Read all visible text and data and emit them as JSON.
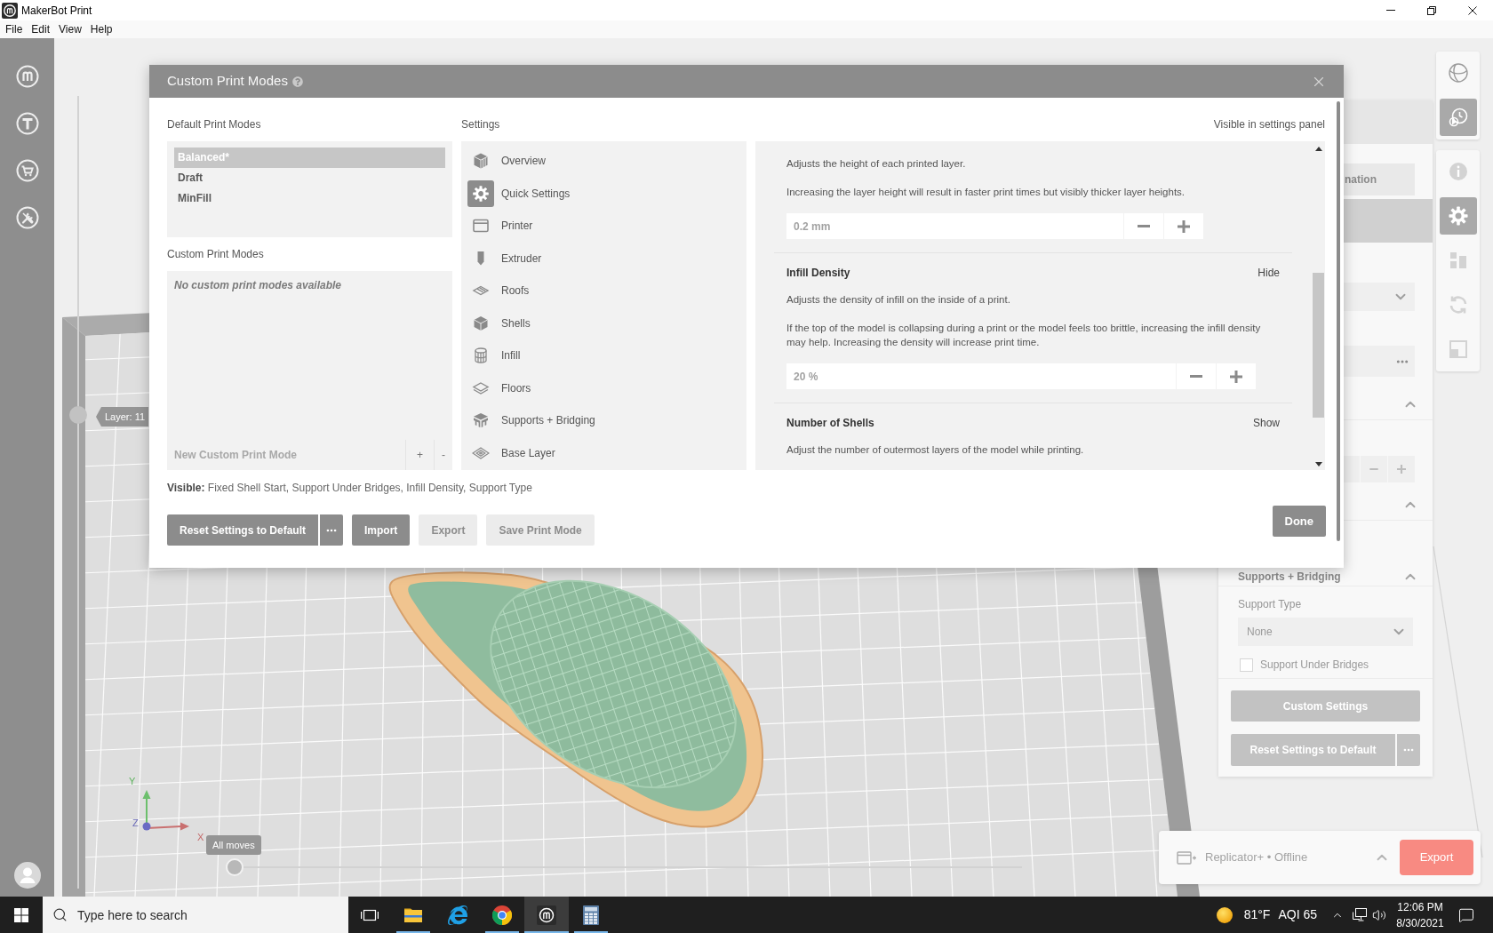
{
  "window": {
    "title": "MakerBot Print"
  },
  "menu": [
    {
      "label": "File"
    },
    {
      "label": "Edit"
    },
    {
      "label": "View"
    },
    {
      "label": "Help"
    }
  ],
  "viewport": {
    "layer_slider": {
      "label": "Layer: 11",
      "level": 0.6
    },
    "moves_slider": {
      "label": "All moves",
      "level": 0
    },
    "axes": {
      "x": "X",
      "y": "Y",
      "z": "Z"
    }
  },
  "dialog": {
    "title": "Custom Print Modes",
    "default_modes": {
      "label": "Default Print Modes",
      "items": [
        {
          "name": "Balanced*",
          "selected": true
        },
        {
          "name": "Draft",
          "selected": false
        },
        {
          "name": "MinFill",
          "selected": false
        }
      ]
    },
    "custom_modes": {
      "label": "Custom Print Modes",
      "empty_text": "No custom print modes available",
      "new_mode": {
        "placeholder": "New Custom Print Mode"
      },
      "add": "+",
      "remove": "-"
    },
    "settings": {
      "label": "Settings",
      "items": [
        {
          "name": "Overview",
          "selected": false
        },
        {
          "name": "Quick Settings",
          "selected": true
        },
        {
          "name": "Printer",
          "selected": false
        },
        {
          "name": "Extruder",
          "selected": false
        },
        {
          "name": "Roofs",
          "selected": false
        },
        {
          "name": "Shells",
          "selected": false
        },
        {
          "name": "Infill",
          "selected": false
        },
        {
          "name": "Floors",
          "selected": false
        },
        {
          "name": "Supports + Bridging",
          "selected": false
        },
        {
          "name": "Base Layer",
          "selected": false
        }
      ]
    },
    "details": {
      "label": "Visible in settings panel",
      "sections": [
        {
          "descriptions": [
            "Adjusts the height of each printed layer.",
            "Increasing the layer height will result in faster print times but visibly thicker layer heights."
          ],
          "value": "0.2 mm"
        },
        {
          "title": "Infill Density",
          "toggle": "Hide",
          "descriptions": [
            "Adjusts the density of infill on the inside of a print.",
            "If the top of the model is collapsing during a print or the model feels too brittle, increasing the infill density may help. Increasing the density will increase print time."
          ],
          "value": "20 %"
        },
        {
          "title": "Number of Shells",
          "toggle": "Show",
          "descriptions": [
            "Adjust the number of outermost layers of the model while printing."
          ]
        }
      ]
    },
    "visible_summary": "**Visible:** Fixed Shell Start, Support Under Bridges, Infill Density, Support Type",
    "buttons": [
      {
        "label": "Reset Settings to Default",
        "kind": "split",
        "disabled": false
      },
      {
        "label": "Import",
        "kind": "plain",
        "disabled": false
      },
      {
        "label": "Export",
        "kind": "plain",
        "disabled": true
      },
      {
        "label": "Save Print Mode",
        "kind": "plain",
        "disabled": true
      }
    ],
    "done": "Done"
  },
  "settings_panel": {
    "partial_button": "nation",
    "section_title": "Supports + Bridging",
    "support_type": {
      "label": "Support Type",
      "value": "None"
    },
    "support_under_bridges": {
      "label": "Support Under Bridges",
      "checked": false
    },
    "custom_settings": "Custom Settings",
    "reset": "Reset Settings to Default"
  },
  "view_tools": [
    {
      "selected": false,
      "disabled": false
    },
    {
      "selected": true,
      "disabled": false
    }
  ],
  "edit_tools": [
    {
      "selected": false,
      "disabled": true
    },
    {
      "selected": true,
      "disabled": false
    },
    {
      "selected": false,
      "disabled": true
    },
    {
      "selected": false,
      "disabled": true
    },
    {
      "selected": false,
      "disabled": true
    }
  ],
  "printer_bar": {
    "printer": "Replicator+ • Offline",
    "export": "Export"
  },
  "taskbar": {
    "search": {
      "placeholder": "Type here to search"
    },
    "apps": [
      {
        "open": true,
        "active": false
      },
      {
        "open": false,
        "active": false
      },
      {
        "open": true,
        "active": false
      },
      {
        "open": true,
        "active": true
      },
      {
        "open": true,
        "active": false
      }
    ],
    "temperature": "81°F",
    "aqi": "AQI 65",
    "time": "12:06 PM",
    "date": "8/30/2021"
  }
}
